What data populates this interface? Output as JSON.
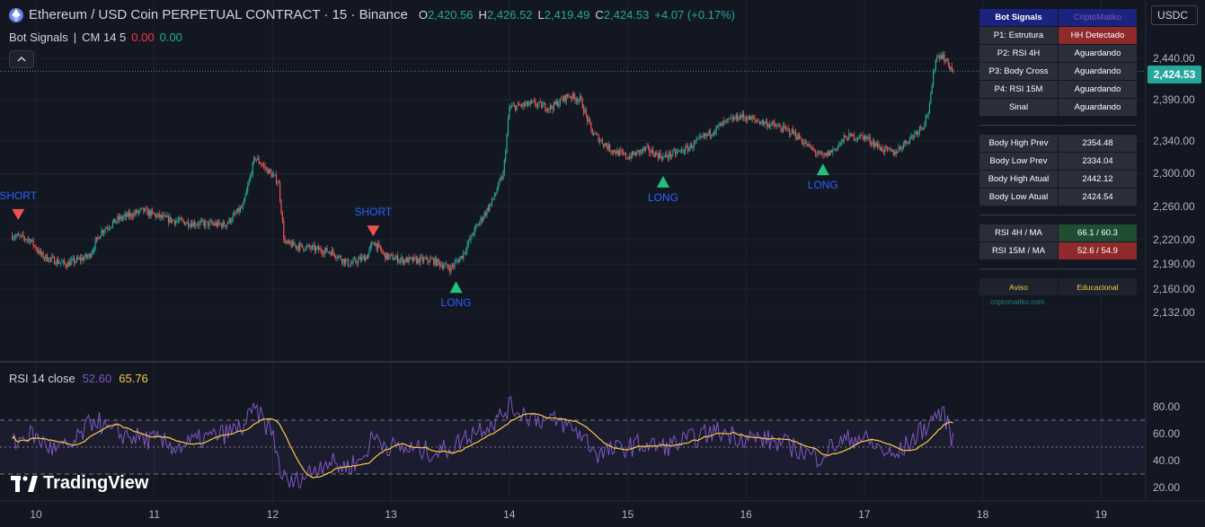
{
  "header": {
    "symbol_title": "Ethereum / USD Coin PERPETUAL CONTRACT · 15 · Binance",
    "open_label": "O",
    "open_value": "2,420.56",
    "high_label": "H",
    "high_value": "2,426.52",
    "low_label": "L",
    "low_value": "2,419.49",
    "close_label": "C",
    "close_value": "2,424.53",
    "change": "+4.07 (+0.17%)"
  },
  "indicator_main": {
    "name": "Bot Signals",
    "sep": "|",
    "params": "CM 14 5",
    "val_red": "0.00",
    "val_green": "0.00"
  },
  "rsi_panel": {
    "name": "RSI 14 close",
    "value1": "52.60",
    "value2": "65.76",
    "ticks": [
      "80.00",
      "60.00",
      "40.00",
      "20.00"
    ]
  },
  "price_axis": {
    "currency": "USDC",
    "current_price": "2,424.53",
    "ticks": [
      "2,440.00",
      "2,390.00",
      "2,340.00",
      "2,300.00",
      "2,260.00",
      "2,220.00",
      "2,190.00",
      "2,160.00",
      "2,132.00"
    ]
  },
  "time_axis": {
    "ticks": [
      "10",
      "11",
      "12",
      "13",
      "14",
      "15",
      "16",
      "17",
      "18",
      "19"
    ]
  },
  "signals": [
    {
      "type": "SHORT",
      "label": "SHORT",
      "day": 9.85,
      "price": 2245
    },
    {
      "type": "SHORT",
      "label": "SHORT",
      "day": 12.85,
      "price": 2225
    },
    {
      "type": "LONG",
      "label": "LONG",
      "day": 13.55,
      "price": 2177
    },
    {
      "type": "LONG",
      "label": "LONG",
      "day": 15.3,
      "price": 2305
    },
    {
      "type": "LONG",
      "label": "LONG",
      "day": 16.65,
      "price": 2320
    }
  ],
  "bot_table": {
    "rows": [
      {
        "left": "Bot Signals",
        "right": "CriptoMatiko",
        "style": "header"
      },
      {
        "left": "P1: Estrutura",
        "right": "HH Detectado",
        "style": "bad"
      },
      {
        "left": "P2: RSI 4H",
        "right": "Aguardando",
        "style": "normal"
      },
      {
        "left": "P3: Body Cross",
        "right": "Aguardando",
        "style": "normal"
      },
      {
        "left": "P4: RSI 15M",
        "right": "Aguardando",
        "style": "normal"
      },
      {
        "left": "Sinal",
        "right": "Aguardando",
        "style": "normal"
      },
      {
        "left": "———————————",
        "right": "———————————",
        "style": "spacer"
      },
      {
        "left": "Body High Prev",
        "right": "2354.48",
        "style": "normal"
      },
      {
        "left": "Body Low Prev",
        "right": "2334.04",
        "style": "normal"
      },
      {
        "left": "Body High Atual",
        "right": "2442.12",
        "style": "normal"
      },
      {
        "left": "Body Low Atual",
        "right": "2424.54",
        "style": "normal"
      },
      {
        "left": "———————————",
        "right": "———————————",
        "style": "spacer"
      },
      {
        "left": "RSI 4H / MA",
        "right": "66.1 / 60.3",
        "style": "good"
      },
      {
        "left": "RSI 15M / MA",
        "right": "52.6 / 54.9",
        "style": "bad"
      },
      {
        "left": "———————————",
        "right": "———————————",
        "style": "spacer"
      },
      {
        "left": "Aviso",
        "right": "Educacional",
        "style": "foot"
      }
    ],
    "credit": "criptomatiko.com"
  },
  "branding": {
    "logo_text": "TradingView"
  },
  "chart_data": {
    "type": "candlestick",
    "x_axis": "day of month",
    "y_axis": "price USDC",
    "ylim": [
      2120,
      2470
    ],
    "xlim": [
      9.8,
      19.5
    ],
    "last_close": 2424.53,
    "anchors": [
      [
        9.8,
        2225
      ],
      [
        9.95,
        2220
      ],
      [
        10.05,
        2200
      ],
      [
        10.25,
        2190
      ],
      [
        10.45,
        2200
      ],
      [
        10.55,
        2230
      ],
      [
        10.7,
        2245
      ],
      [
        10.9,
        2255
      ],
      [
        11.1,
        2245
      ],
      [
        11.3,
        2240
      ],
      [
        11.6,
        2238
      ],
      [
        11.75,
        2260
      ],
      [
        11.85,
        2320
      ],
      [
        11.95,
        2305
      ],
      [
        12.05,
        2290
      ],
      [
        12.1,
        2215
      ],
      [
        12.3,
        2210
      ],
      [
        12.5,
        2205
      ],
      [
        12.65,
        2190
      ],
      [
        12.8,
        2200
      ],
      [
        12.85,
        2218
      ],
      [
        12.95,
        2200
      ],
      [
        13.1,
        2195
      ],
      [
        13.35,
        2195
      ],
      [
        13.5,
        2185
      ],
      [
        13.6,
        2200
      ],
      [
        13.7,
        2230
      ],
      [
        13.85,
        2265
      ],
      [
        13.95,
        2300
      ],
      [
        14.0,
        2380
      ],
      [
        14.2,
        2385
      ],
      [
        14.35,
        2380
      ],
      [
        14.5,
        2395
      ],
      [
        14.6,
        2390
      ],
      [
        14.7,
        2350
      ],
      [
        14.85,
        2330
      ],
      [
        15.0,
        2320
      ],
      [
        15.15,
        2330
      ],
      [
        15.3,
        2320
      ],
      [
        15.5,
        2330
      ],
      [
        15.65,
        2345
      ],
      [
        15.8,
        2360
      ],
      [
        15.95,
        2370
      ],
      [
        16.2,
        2360
      ],
      [
        16.4,
        2350
      ],
      [
        16.55,
        2330
      ],
      [
        16.65,
        2320
      ],
      [
        16.75,
        2330
      ],
      [
        16.85,
        2345
      ],
      [
        17.0,
        2345
      ],
      [
        17.15,
        2330
      ],
      [
        17.25,
        2325
      ],
      [
        17.4,
        2345
      ],
      [
        17.5,
        2360
      ],
      [
        17.55,
        2380
      ],
      [
        17.6,
        2440
      ],
      [
        17.65,
        2445
      ],
      [
        17.75,
        2424.53
      ]
    ],
    "rsi": {
      "length": 14,
      "ylim": [
        15,
        90
      ],
      "levels": [
        70,
        50,
        30
      ],
      "anchors": [
        [
          9.8,
          52
        ],
        [
          9.95,
          60
        ],
        [
          10.15,
          48
        ],
        [
          10.3,
          50
        ],
        [
          10.5,
          72
        ],
        [
          10.6,
          62
        ],
        [
          10.8,
          58
        ],
        [
          11.0,
          55
        ],
        [
          11.2,
          50
        ],
        [
          11.4,
          56
        ],
        [
          11.6,
          60
        ],
        [
          11.75,
          65
        ],
        [
          11.85,
          78
        ],
        [
          12.0,
          60
        ],
        [
          12.08,
          28
        ],
        [
          12.15,
          22
        ],
        [
          12.3,
          30
        ],
        [
          12.45,
          40
        ],
        [
          12.6,
          35
        ],
        [
          12.75,
          40
        ],
        [
          12.85,
          58
        ],
        [
          13.0,
          50
        ],
        [
          13.2,
          48
        ],
        [
          13.4,
          46
        ],
        [
          13.55,
          52
        ],
        [
          13.7,
          62
        ],
        [
          13.9,
          70
        ],
        [
          14.0,
          80
        ],
        [
          14.2,
          72
        ],
        [
          14.45,
          68
        ],
        [
          14.6,
          60
        ],
        [
          14.75,
          45
        ],
        [
          14.9,
          48
        ],
        [
          15.1,
          52
        ],
        [
          15.3,
          50
        ],
        [
          15.5,
          55
        ],
        [
          15.75,
          62
        ],
        [
          15.95,
          58
        ],
        [
          16.2,
          55
        ],
        [
          16.4,
          50
        ],
        [
          16.6,
          42
        ],
        [
          16.75,
          52
        ],
        [
          16.95,
          58
        ],
        [
          17.15,
          48
        ],
        [
          17.25,
          42
        ],
        [
          17.4,
          55
        ],
        [
          17.55,
          68
        ],
        [
          17.62,
          76
        ],
        [
          17.7,
          70
        ],
        [
          17.75,
          53
        ]
      ],
      "ma_length": 14
    }
  }
}
